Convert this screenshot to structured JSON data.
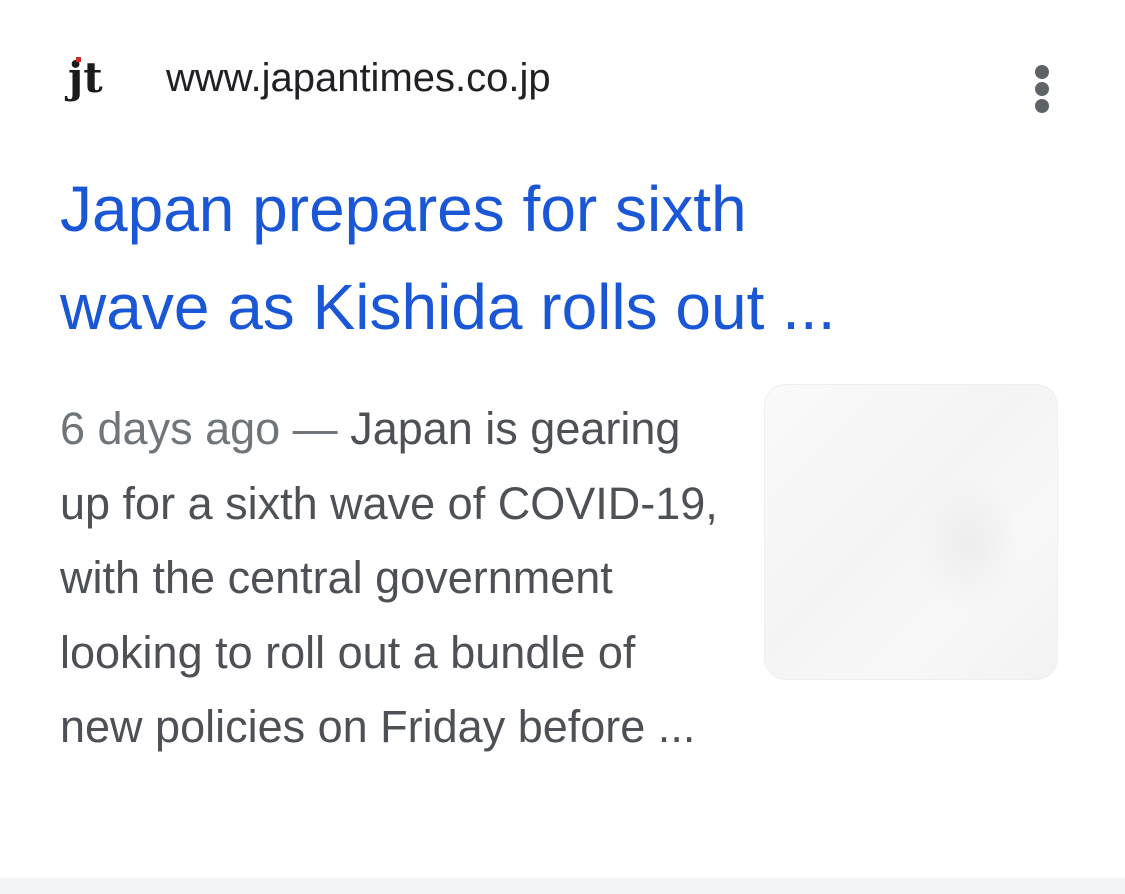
{
  "result": {
    "site": {
      "favicon_text": "jt",
      "favicon_colors": {
        "text": "#1b1b1b",
        "accent": "#d2262b"
      },
      "url": "www.japantimes.co.jp"
    },
    "menu": {
      "icon": "more-vert-icon"
    },
    "title": {
      "line1": "Japan prepares for sixth",
      "line2": "wave as Kishida rolls out ..."
    },
    "snippet": {
      "date": "6 days ago",
      "separator": " — ",
      "text": "Japan is gearing up for a sixth wave of COVID-19, with the central government looking to roll out a bundle of new policies on Friday before ..."
    },
    "colors": {
      "title": "#1a57d6",
      "snippet": "#4d5156",
      "date": "#70757a",
      "url": "#202124"
    }
  }
}
